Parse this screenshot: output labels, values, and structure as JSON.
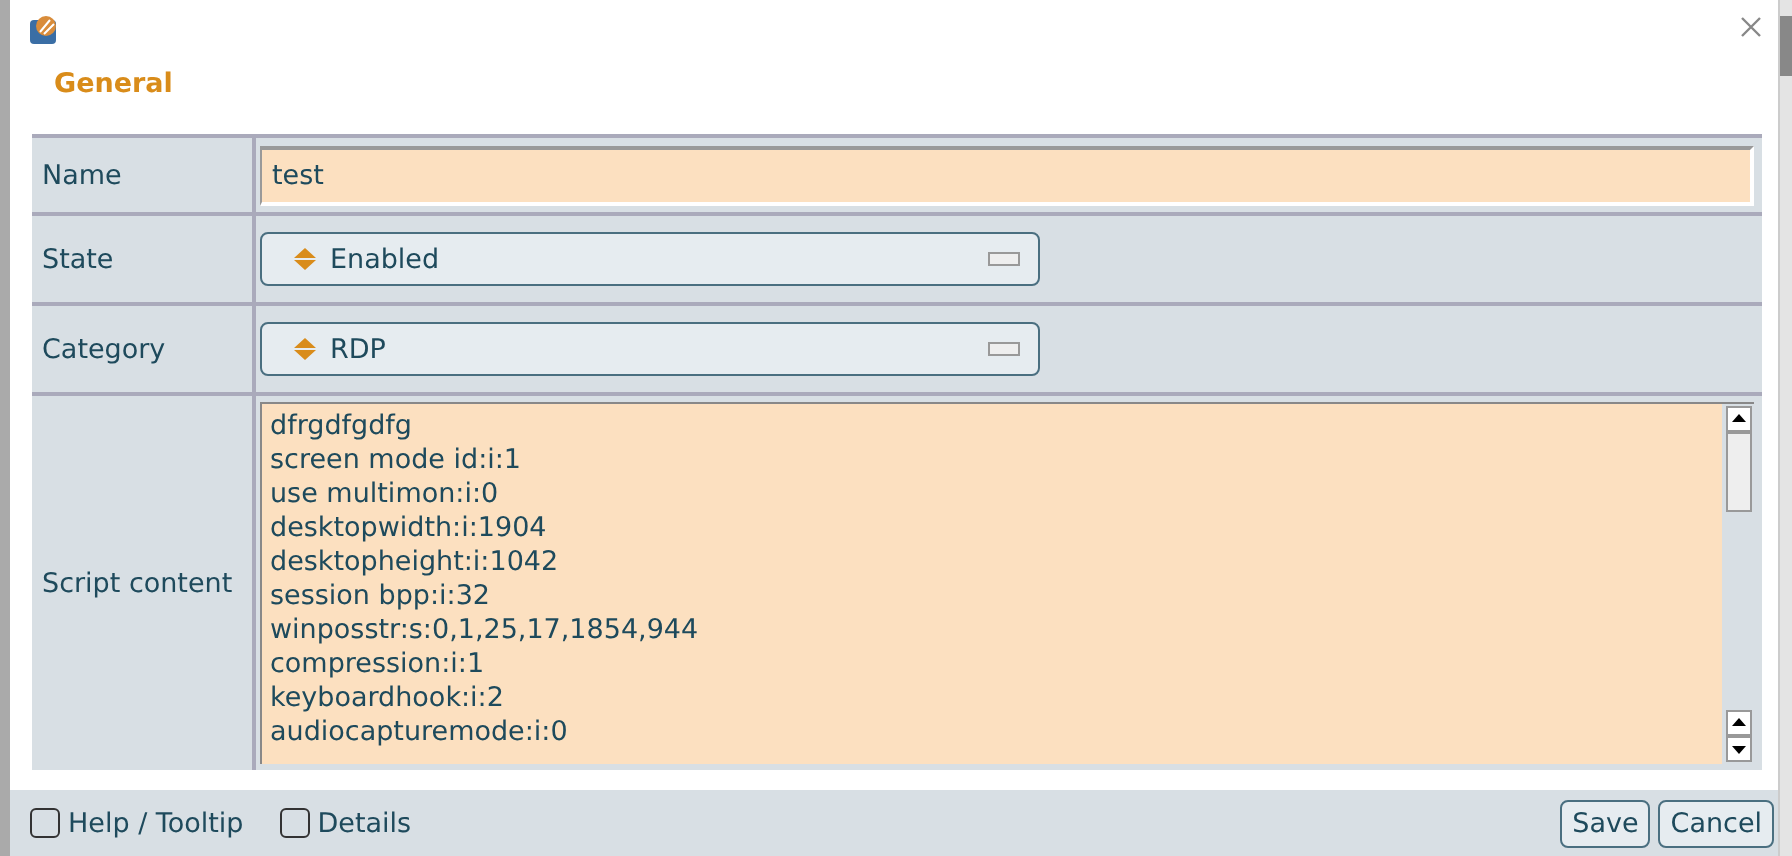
{
  "dialog": {
    "section_title": "General"
  },
  "fields": [
    {
      "label": "Name",
      "kind": "text",
      "value": "test"
    },
    {
      "label": "State",
      "kind": "select",
      "value": "Enabled"
    },
    {
      "label": "Category",
      "kind": "select",
      "value": "RDP"
    },
    {
      "label": "Script content",
      "kind": "textarea",
      "lines": [
        "dfrgdfgdfg",
        "screen mode id:i:1",
        "use multimon:i:0",
        "desktopwidth:i:1904",
        "desktopheight:i:1042",
        "session bpp:i:32",
        "winposstr:s:0,1,25,17,1854,944",
        "compression:i:1",
        "keyboardhook:i:2",
        "audiocapturemode:i:0"
      ]
    }
  ],
  "footer": {
    "options": [
      {
        "label": "Help / Tooltip",
        "checked": false
      },
      {
        "label": "Details",
        "checked": false
      }
    ],
    "buttons": [
      "Save",
      "Cancel"
    ]
  }
}
